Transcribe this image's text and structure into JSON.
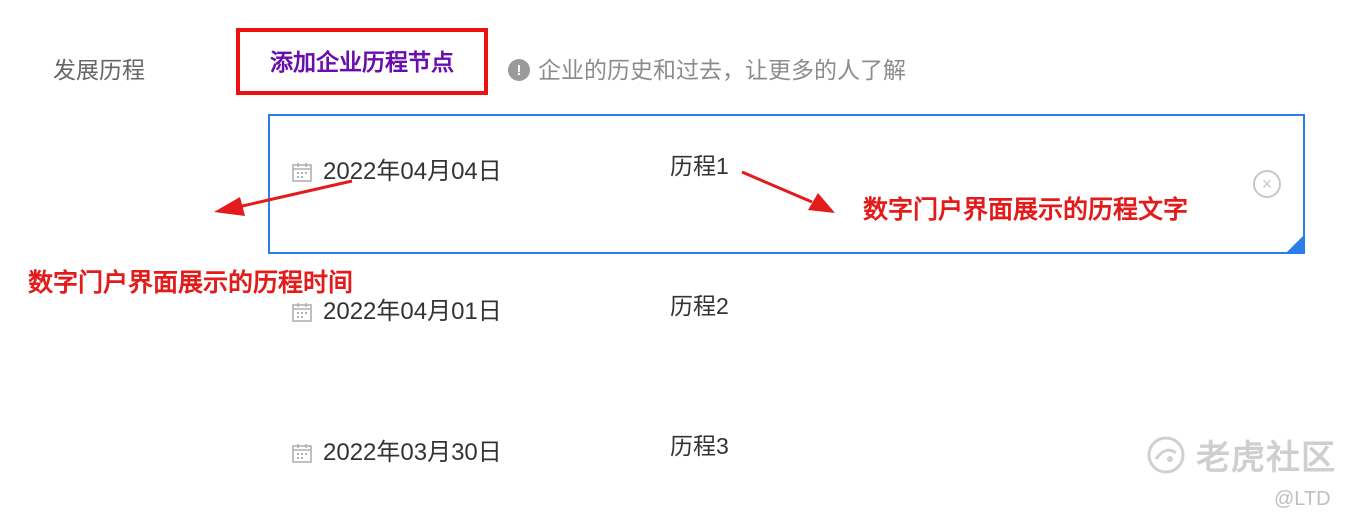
{
  "form": {
    "label": "发展历程",
    "add_node_button": "添加企业历程节点",
    "hint": "企业的历史和过去，让更多的人了解"
  },
  "timeline": [
    {
      "date": "2022年04月04日",
      "text": "历程1",
      "selected": true
    },
    {
      "date": "2022年04月01日",
      "text": "历程2",
      "selected": false
    },
    {
      "date": "2022年03月30日",
      "text": "历程3",
      "selected": false
    }
  ],
  "annotations": {
    "time": "数字门户界面展示的历程时间",
    "text": "数字门户界面展示的历程文字"
  },
  "watermark": {
    "brand": "老虎社区",
    "sub": "@LTD"
  },
  "colors": {
    "accent_blue": "#2b7de9",
    "annotation_red": "#e31b1b",
    "button_purple": "#6a0dad"
  }
}
